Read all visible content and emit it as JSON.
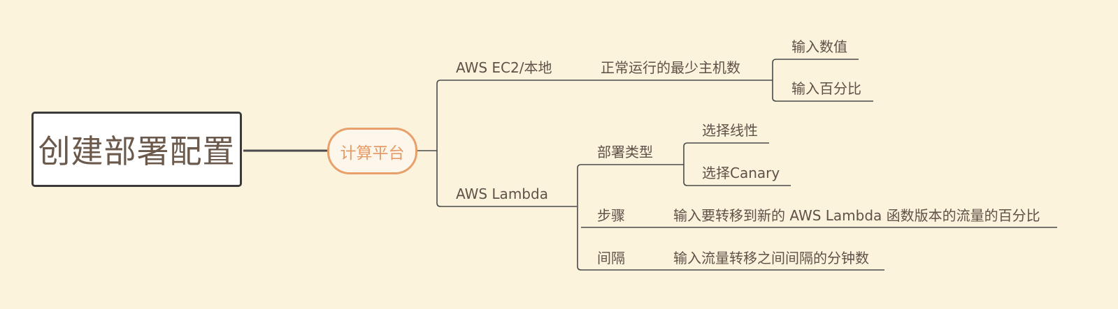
{
  "colors": {
    "background": "#fcf3dd",
    "line": "#4a4a4a",
    "root_border": "#3a3a3a",
    "accent": "#e8a06b",
    "text": "#5e5248"
  },
  "root": {
    "label": "创建部署配置"
  },
  "platform": {
    "label": "计算平台"
  },
  "ec2": {
    "label": "AWS EC2/本地",
    "min_hosts": {
      "label": "正常运行的最少主机数",
      "options": [
        "输入数值",
        "输入百分比"
      ]
    }
  },
  "lambda": {
    "label": "AWS Lambda",
    "deploy_type": {
      "label": "部署类型",
      "options": [
        "选择线性",
        "选择Canary"
      ]
    },
    "step": {
      "label": "步骤",
      "detail": "输入要转移到新的 AWS Lambda 函数版本的流量的百分比"
    },
    "interval": {
      "label": "间隔",
      "detail": "输入流量转移之间间隔的分钟数"
    }
  }
}
